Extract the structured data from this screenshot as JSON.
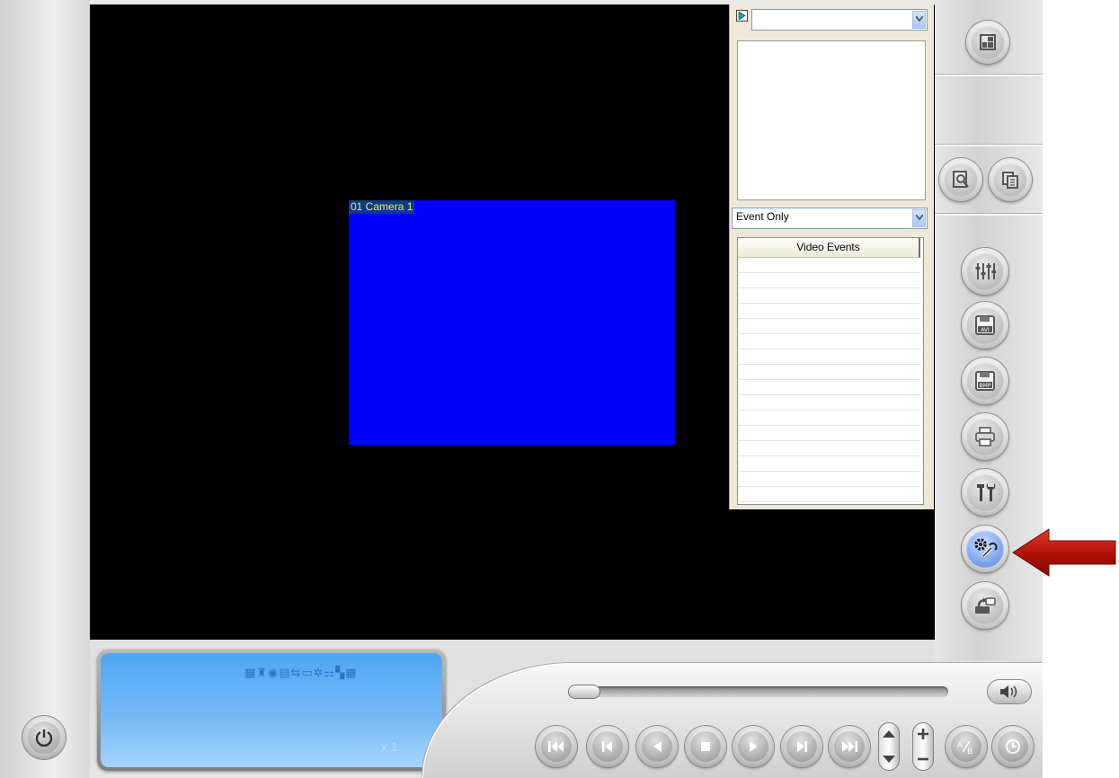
{
  "video": {
    "camera_label": "01 Camera 1"
  },
  "side_panel": {
    "top_combo_value": "",
    "filter_combo_value": "Event Only",
    "events_column": "Video Events"
  },
  "right_toolbar": [
    {
      "name": "layout-button",
      "icon": "layout-icon"
    },
    {
      "name": "search-button",
      "icon": "search-icon"
    },
    {
      "name": "copy-button",
      "icon": "copy-icon"
    },
    {
      "name": "adjust-button",
      "icon": "sliders-icon"
    },
    {
      "name": "save-avi-button",
      "icon": "save-avi-icon"
    },
    {
      "name": "save-bmp-button",
      "icon": "save-bmp-icon"
    },
    {
      "name": "print-button",
      "icon": "print-icon"
    },
    {
      "name": "tools-button",
      "icon": "tools-icon"
    },
    {
      "name": "settings-button",
      "icon": "gear-wrench-icon",
      "highlighted": true
    },
    {
      "name": "export-button",
      "icon": "export-icon"
    }
  ],
  "status_display": {
    "speed": "x 1"
  },
  "playback": {
    "position_fraction": 0.0,
    "buttons": [
      "first",
      "previous",
      "reverse",
      "stop",
      "play",
      "next",
      "last"
    ]
  },
  "colors": {
    "accent_blue": "#4f7fe0",
    "camera_bg": "#0000ff",
    "lcd_blue": "#78bcf7",
    "arrow_red": "#c8180c"
  }
}
